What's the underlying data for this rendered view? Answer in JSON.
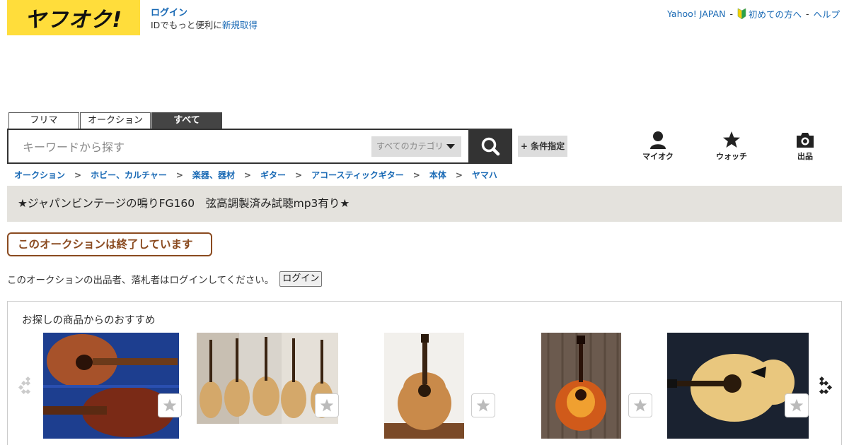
{
  "header": {
    "logo_text": "ヤフオク!",
    "login_link": "ログイン",
    "login_desc": "IDでもっと便利に",
    "signup_link": "新規取得",
    "top_links": [
      "Yahoo! JAPAN",
      "初めての方へ",
      "ヘルプ"
    ],
    "top_sep": "-"
  },
  "tabs": [
    "フリマ",
    "オークション",
    "すべて"
  ],
  "search": {
    "placeholder": "キーワードから探す",
    "category": "すべてのカテゴリ",
    "condition_button": "+ 条件指定"
  },
  "quick_links": [
    "マイオク",
    "ウォッチ",
    "出品"
  ],
  "breadcrumb": [
    "オークション",
    "ホビー、カルチャー",
    "楽器、器材",
    "ギター",
    "アコースティックギター",
    "本体",
    "ヤマハ"
  ],
  "breadcrumb_sep": ">",
  "item_title": "★ジャパンビンテージの鳴りFG160　弦高調製済み試聴mp3有り★",
  "ended_label": "このオークションは終了しています",
  "notice": {
    "text": "このオークションの出品者、落札者はログインしてください。",
    "button": "ログイン"
  },
  "recommend": {
    "title": "お探しの商品からのおすすめ",
    "items": [
      {
        "image": "guitar-case-photo"
      },
      {
        "image": "guitar-lineup-photo"
      },
      {
        "image": "acoustic-guitar-photo"
      },
      {
        "image": "sunburst-guitar-photo"
      },
      {
        "image": "natural-guitar-photo"
      }
    ]
  },
  "colors": {
    "logo_bg": "#ffdd3b",
    "link": "#1a6ab5",
    "ended": "#8a4a1f",
    "title_bar": "#e4e2dd"
  }
}
